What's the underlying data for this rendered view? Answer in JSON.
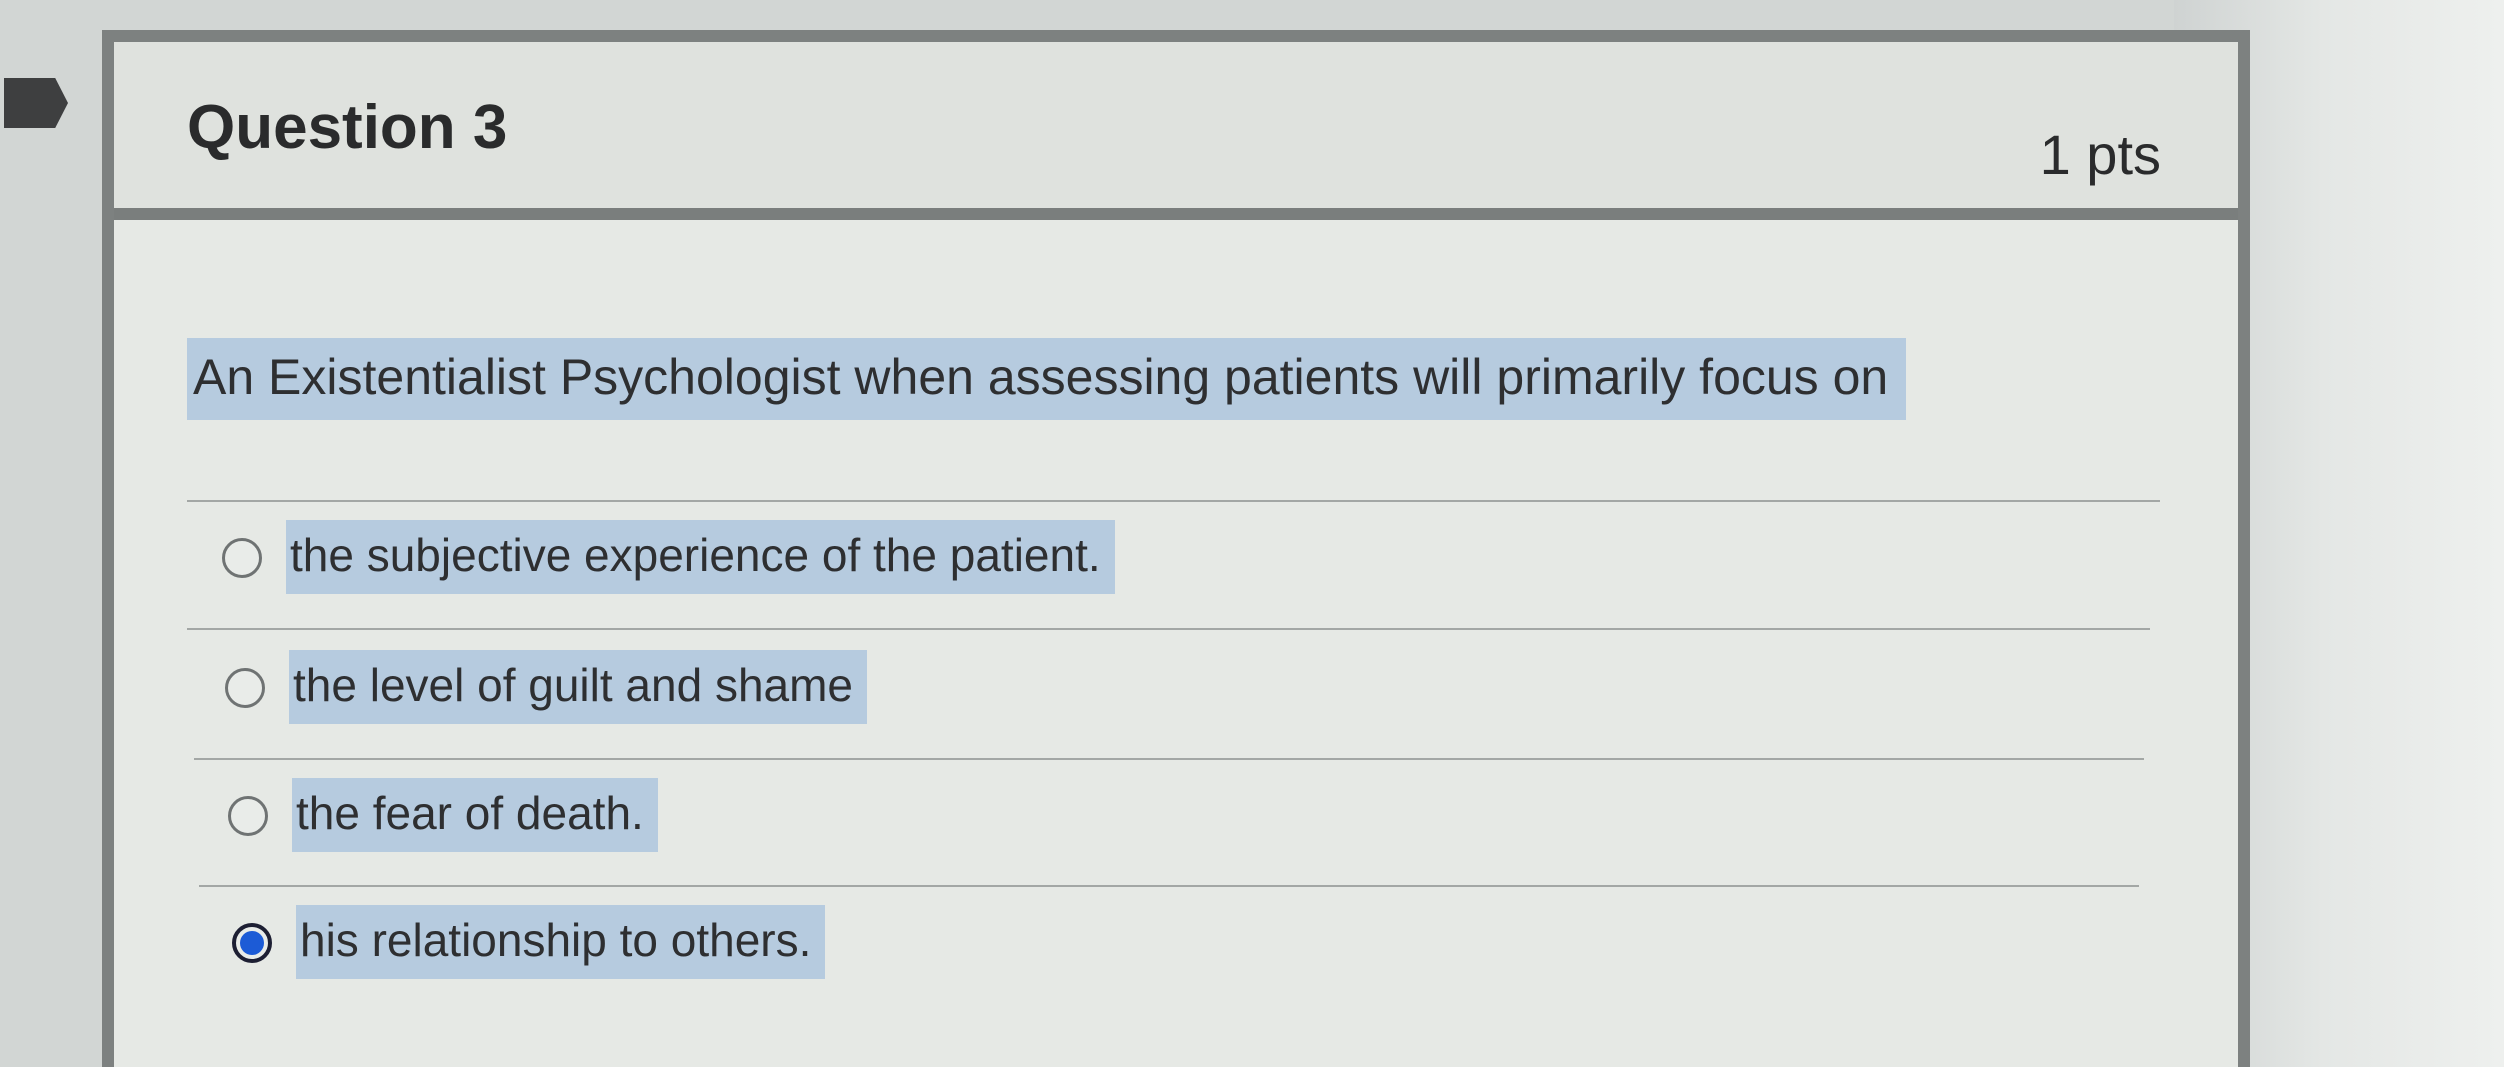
{
  "question": {
    "title": "Question 3",
    "points": "1 pts",
    "text": "An Existentialist Psychologist when assessing patients will primarily focus on"
  },
  "answers": [
    {
      "label": "the subjective experience of the patient.",
      "selected": false
    },
    {
      "label": "the level of guilt and shame",
      "selected": false
    },
    {
      "label": "the fear of death.",
      "selected": false
    },
    {
      "label": "his relationship to others.",
      "selected": true
    }
  ],
  "colors": {
    "highlight": "#b6cbdf",
    "radio_selected": "#1c5bd6",
    "card_border": "#7d8180",
    "bookmark": "#3e3f40"
  },
  "icons": {
    "bookmark": "bookmark-flag-icon",
    "radio_unselected": "radio-unchecked-icon",
    "radio_selected": "radio-checked-icon"
  }
}
